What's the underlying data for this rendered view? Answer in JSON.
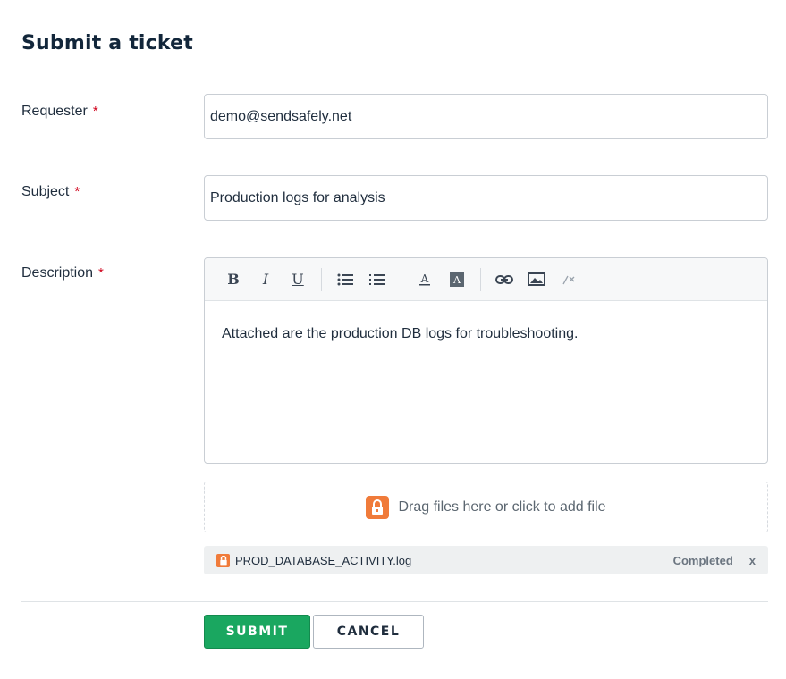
{
  "title": "Submit a ticket",
  "required_marker": "*",
  "fields": {
    "requester": {
      "label": "Requester",
      "value": "demo@sendsafely.net"
    },
    "subject": {
      "label": "Subject",
      "value": "Production logs for analysis"
    },
    "description": {
      "label": "Description",
      "value": "Attached are the production DB logs for troubleshooting."
    }
  },
  "toolbar": {
    "bold": "B",
    "italic": "I",
    "underline": "U",
    "icons": [
      "bold-icon",
      "italic-icon",
      "underline-icon",
      "bulleted-list-icon",
      "numbered-list-icon",
      "text-color-icon",
      "background-color-icon",
      "link-icon",
      "image-icon",
      "clear-formatting-icon"
    ]
  },
  "dropzone": {
    "text": "Drag files here or click to add file",
    "icon": "lock-icon"
  },
  "attachment": {
    "filename": "PROD_DATABASE_ACTIVITY.log",
    "status": "Completed",
    "remove": "x"
  },
  "buttons": {
    "submit": "SUBMIT",
    "cancel": "CANCEL"
  },
  "colors": {
    "accent": "#1aa760",
    "required": "#d0021b",
    "lock": "#f07b3a"
  }
}
